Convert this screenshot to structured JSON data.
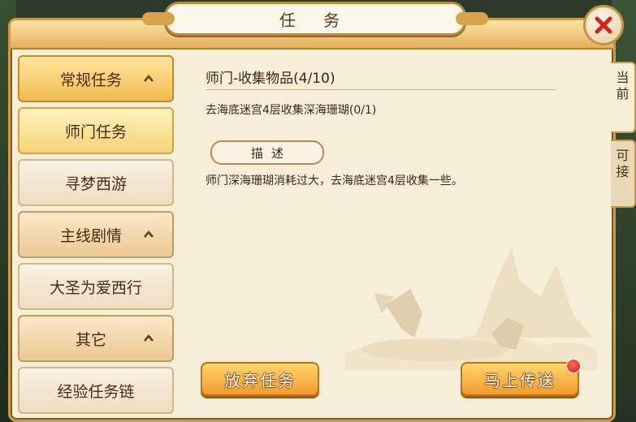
{
  "window": {
    "title": "任 务"
  },
  "sidebar": {
    "items": [
      {
        "label": "常规任务",
        "kind": "category",
        "expanded": true,
        "active": true
      },
      {
        "label": "师门任务",
        "kind": "quest",
        "selected": true
      },
      {
        "label": "寻梦西游",
        "kind": "quest"
      },
      {
        "label": "主线剧情",
        "kind": "category",
        "expanded": true
      },
      {
        "label": "大圣为爱西行",
        "kind": "quest"
      },
      {
        "label": "其它",
        "kind": "category",
        "expanded": true
      },
      {
        "label": "经验任务链",
        "kind": "quest"
      }
    ]
  },
  "quest": {
    "title": "师门-收集物品(4/10)",
    "goal": "去海底迷宫4层收集深海珊瑚(0/1)",
    "desc_label": "描述",
    "description": "师门深海珊瑚消耗过大，去海底迷宫4层收集一些。"
  },
  "buttons": {
    "abandon": "放弃任务",
    "teleport": "马上传送"
  },
  "tabs": {
    "current": "当前",
    "available": "可接"
  },
  "colors": {
    "accent": "#f19a2c",
    "panel": "#f7eed8",
    "border": "#c99a4c",
    "notify": "#d41c10"
  },
  "icons": {
    "close": "close-icon",
    "chevron": "chevron-up-icon"
  }
}
